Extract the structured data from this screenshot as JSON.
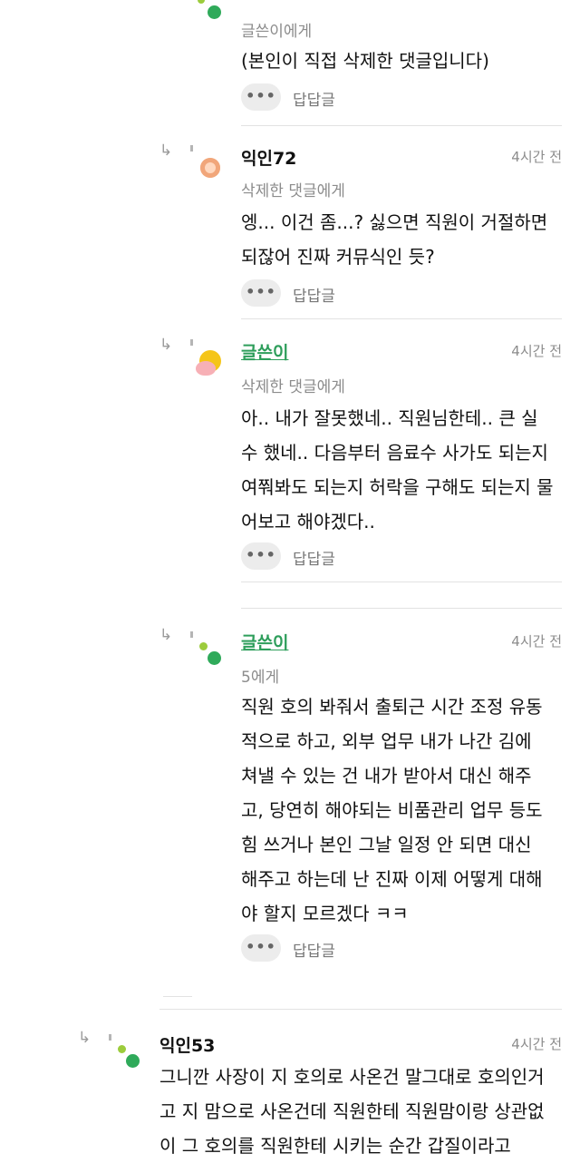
{
  "comments": [
    {
      "to": "글쓴이에게",
      "text": "(본인이 직접 삭제한 댓글입니다)",
      "more": "•••",
      "reply": "답답글"
    },
    {
      "author": "익인72",
      "time": "4시간 전",
      "to": "삭제한 댓글에게",
      "text": "엥... 이건 좀...? 싫으면 직원이 거절하면\n되잖어 진짜 커뮤식인 듯?",
      "more": "•••",
      "reply": "답답글"
    },
    {
      "author": "글쓴이",
      "time": "4시간 전",
      "to": "삭제한 댓글에게",
      "text": "아.. 내가 잘못했네.. 직원님한테.. 큰 실\n수 했네.. 다음부터 음료수 사가도 되는지\n여쭤봐도 되는지 허락을 구해도 되는지 물\n어보고 해야겠다..",
      "more": "•••",
      "reply": "답답글"
    },
    {
      "author": "글쓴이",
      "time": "4시간 전",
      "to": "5에게",
      "text": "직원 호의 봐줘서 출퇴근 시간 조정 유동\n적으로 하고, 외부 업무 내가 나간 김에\n쳐낼 수 있는 건 내가 받아서 대신 해주\n고, 당연히 해야되는 비품관리 업무 등도\n힘 쓰거나 본인 그날 일정 안 되면 대신\n해주고 하는데 난 진짜 이제 어떻게 대해\n야 할지 모르겠다 ㅋㅋ",
      "more": "•••",
      "reply": "답답글"
    },
    {
      "author": "익인53",
      "time": "4시간 전",
      "text": "그니깐 사장이 지 호의로 사온건 말그대로 호의인거\n고 지 맘으로 사온건데 직원한테 직원맘이랑 상관없\n이 그 호의를 직원한테 시키는 순간 갑질이라고"
    }
  ],
  "colors": {
    "op_name": "#2e9e5b",
    "meta": "#8c8c8c",
    "divider": "#e2e2e2"
  }
}
